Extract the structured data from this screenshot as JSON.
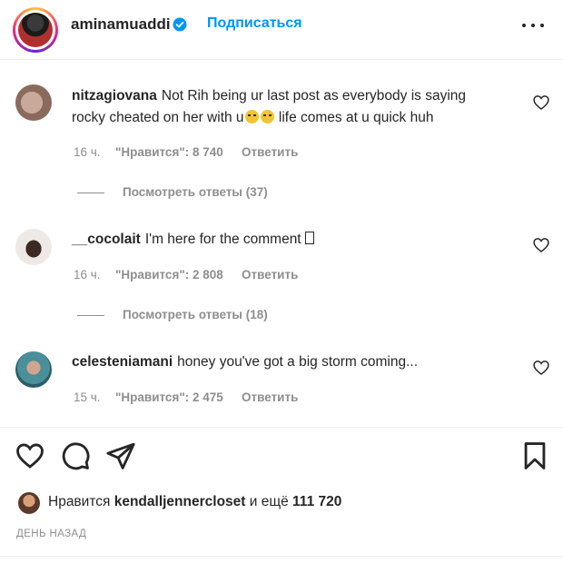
{
  "header": {
    "username": "aminamuaddi",
    "follow_label": "Подписаться"
  },
  "comments": [
    {
      "username": "nitzagiovana",
      "text_line1": "Not Rih being ur last post as everybody is saying",
      "text_line2_start": "rocky cheated on her with u",
      "text_line2_end": " life comes at u quick huh",
      "time": "16 ч.",
      "likes": "\"Нравится\": 8 740",
      "reply_label": "Ответить",
      "view_replies": "Посмотреть ответы (37)"
    },
    {
      "username": "__cocolait",
      "text": "I'm here for the comment",
      "time": "16 ч.",
      "likes": "\"Нравится\": 2 808",
      "reply_label": "Ответить",
      "view_replies": "Посмотреть ответы (18)"
    },
    {
      "username": "celesteniamani",
      "text": "honey you've got a big storm coming...",
      "time": "15 ч.",
      "likes": "\"Нравится\": 2 475",
      "reply_label": "Ответить"
    }
  ],
  "likes_summary": {
    "prefix": "Нравится",
    "liked_by": "kendalljennercloset",
    "connector": "и ещё",
    "others_count": "111 720"
  },
  "post_date": "ДЕНЬ НАЗАД",
  "colors": {
    "accent": "#0095f6",
    "text": "#262626",
    "muted": "#8e8e8e",
    "verified": "#0095f6"
  },
  "icons": [
    "verified-icon",
    "more-options-icon",
    "heart-icon",
    "comment-icon",
    "share-icon",
    "bookmark-icon"
  ]
}
